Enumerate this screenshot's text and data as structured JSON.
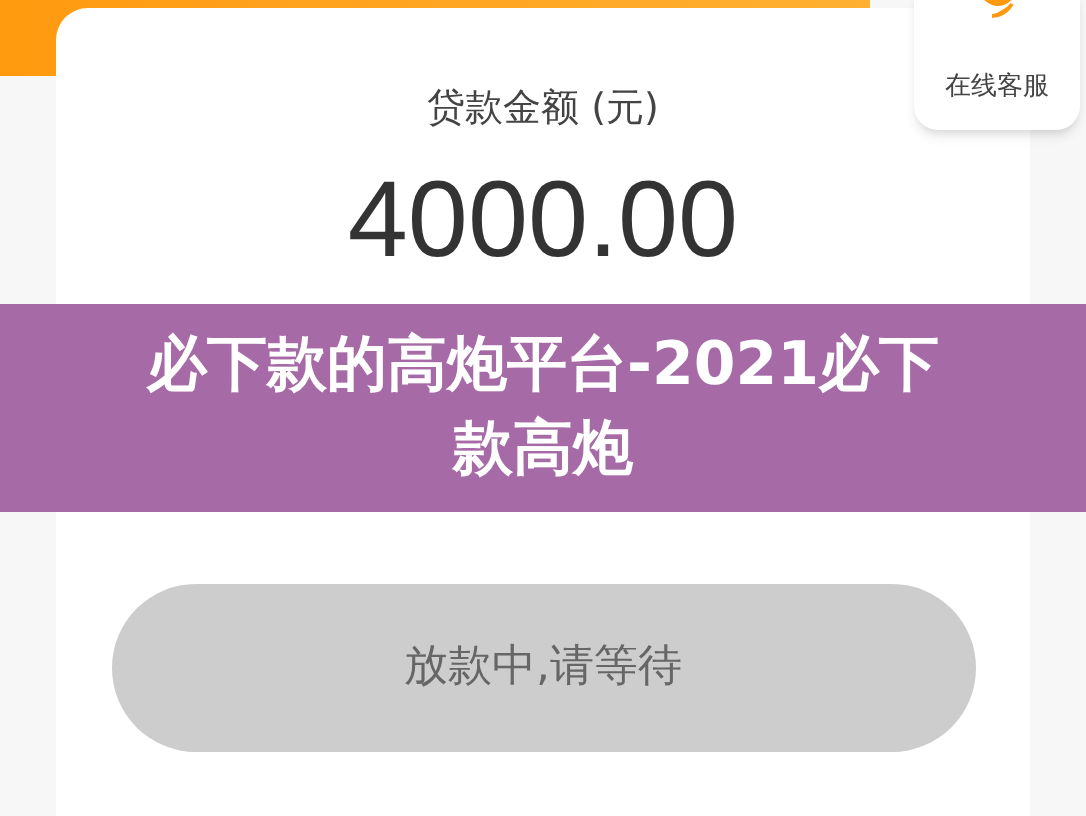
{
  "service_widget": {
    "label": "在线客服"
  },
  "loan_card": {
    "amount_label": "贷款金额 (元)",
    "amount": "4000.00"
  },
  "status_button": {
    "label": "放款中,请等待",
    "disabled": true
  },
  "title_banner": {
    "text": "必下款的高炮平台-2021必下款高炮"
  }
}
